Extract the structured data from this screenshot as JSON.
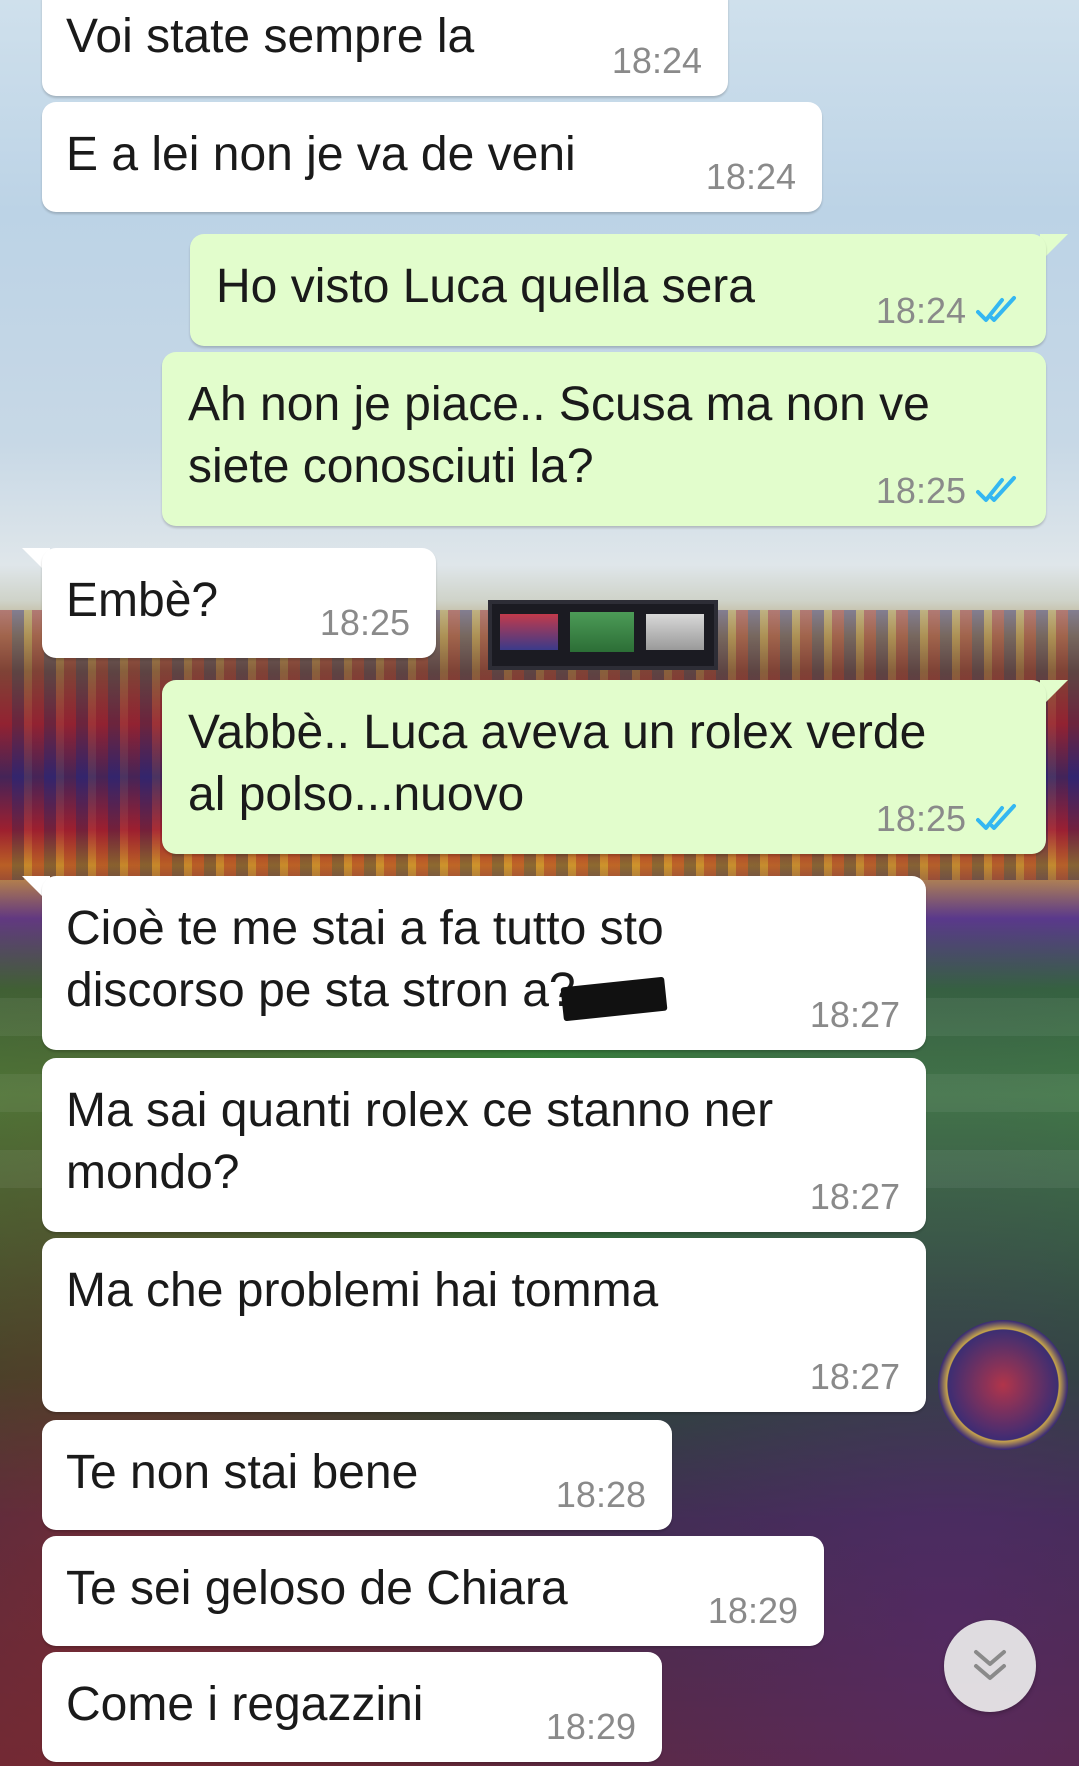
{
  "theme": {
    "incoming_bubble": "#ffffff",
    "outgoing_bubble": "#e2fdcc",
    "tick_color": "#34b7f1",
    "time_color": "#8a8a8a"
  },
  "messages": [
    {
      "direction": "in",
      "text": "Voi state sempre la",
      "time": "18:24"
    },
    {
      "direction": "in",
      "text": "E a lei non je va de veni",
      "time": "18:24"
    },
    {
      "direction": "out",
      "text": "Ho visto Luca quella sera",
      "time": "18:24",
      "status": "read"
    },
    {
      "direction": "out",
      "text": "Ah non je piace.. Scusa ma non ve\nsiete conosciuti la?",
      "time": "18:25",
      "status": "read"
    },
    {
      "direction": "in",
      "text": "Embè?",
      "time": "18:25"
    },
    {
      "direction": "out",
      "text": "Vabbè.. Luca aveva un rolex verde\nal polso...nuovo",
      "time": "18:25",
      "status": "read"
    },
    {
      "direction": "in",
      "text": "Cioè te me stai a fa tutto sto\ndiscorso pe sta stron    a?",
      "time": "18:27",
      "redacted": true
    },
    {
      "direction": "in",
      "text": "Ma sai quanti rolex ce stanno ner\nmondo?",
      "time": "18:27"
    },
    {
      "direction": "in",
      "text": "Ma che problemi hai tomma",
      "time": "18:27"
    },
    {
      "direction": "in",
      "text": "Te non stai bene",
      "time": "18:28"
    },
    {
      "direction": "in",
      "text": "Te sei geloso de Chiara",
      "time": "18:29"
    },
    {
      "direction": "in",
      "text": "Come i regazzini",
      "time": "18:29"
    }
  ],
  "icons": {
    "read_receipt": "double-check-icon",
    "scroll_down": "double-chevron-down-icon"
  }
}
